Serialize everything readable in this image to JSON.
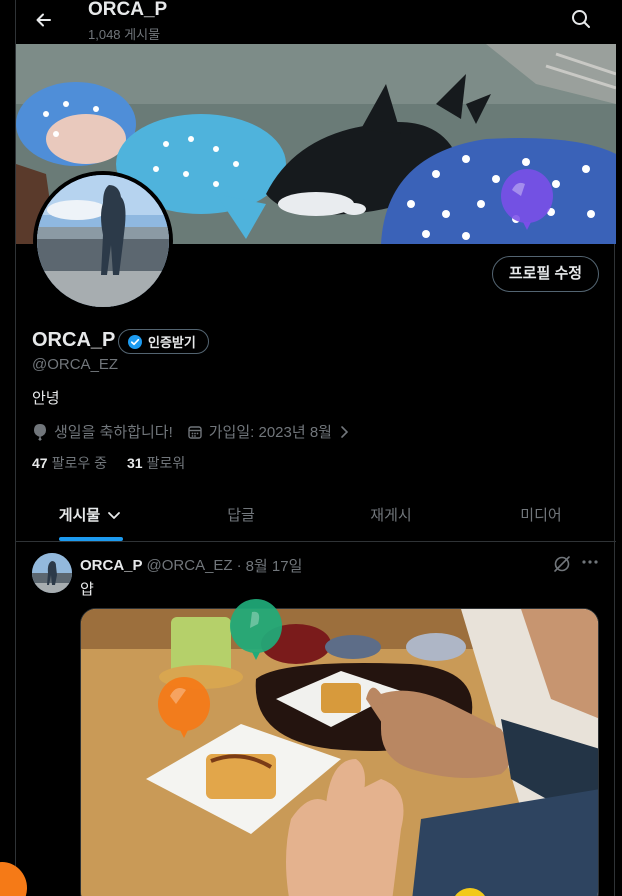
{
  "header": {
    "name": "ORCA_P",
    "post_count": "1,048 게시물"
  },
  "icons": {
    "back": "arrow-left-icon",
    "search": "search-icon",
    "verified": "verified-badge-icon",
    "birthday": "balloon-icon",
    "calendar": "calendar-icon",
    "chevron": "chevron-right-icon",
    "tab_chevron": "chevron-down-icon",
    "grok": "grok-icon",
    "more": "more-icon"
  },
  "profile": {
    "edit_button": "프로필 수정",
    "display_name": "ORCA_P",
    "verify_label": "인증받기",
    "handle": "@ORCA_EZ",
    "bio": "안녕",
    "birthday": "생일을 축하합니다!",
    "joined": "가입일: 2023년 8월",
    "following_count": "47",
    "following_label": "팔로우 중",
    "followers_count": "31",
    "followers_label": "팔로워"
  },
  "tabs": [
    {
      "label": "게시물",
      "active": true
    },
    {
      "label": "답글",
      "active": false
    },
    {
      "label": "재게시",
      "active": false
    },
    {
      "label": "미디어",
      "active": false
    }
  ],
  "post": {
    "name": "ORCA_P",
    "handle": "@ORCA_EZ",
    "separator": "·",
    "date": "8월 17일",
    "text": "얍"
  },
  "colors": {
    "accent": "#1d9bf0",
    "background": "#000000",
    "text_primary": "#e7e9ea",
    "text_secondary": "#71767b",
    "border": "#2f3336"
  },
  "balloons": [
    {
      "name": "purple-balloon",
      "color": "#7b4ee8"
    },
    {
      "name": "blue-balloon",
      "color": "#1d8fe0"
    },
    {
      "name": "green-balloon",
      "color": "#1fab7a"
    },
    {
      "name": "orange-balloon",
      "color": "#f57a17"
    },
    {
      "name": "orange-corner-balloon",
      "color": "#f57a17"
    },
    {
      "name": "yellow-corner-balloon",
      "color": "#f2c919"
    }
  ]
}
